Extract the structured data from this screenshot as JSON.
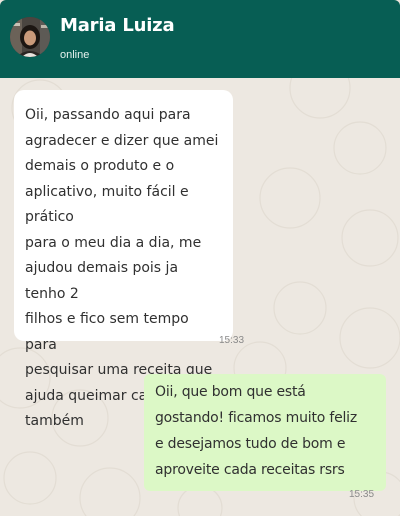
{
  "contact": {
    "name": "Maria Luiza",
    "status": "online"
  },
  "messages": [
    {
      "direction": "incoming",
      "text": "Oii, passando aqui para\nagradecer e dizer que amei\ndemais o produto e o\naplicativo, muito fácil e prático\npara o meu dia a dia, me\najudou demais pois ja tenho 2\nfilhos e fico sem tempo para\npesquisar uma receita que\najuda queimar calorias\ntambém",
      "time": "15:33"
    },
    {
      "direction": "outgoing",
      "text": "Oii, que bom que está\ngostando! ficamos muito feliz\ne desejamos tudo de bom e\naproveite cada receitas rsrs",
      "time": "15:35"
    }
  ],
  "colors": {
    "header": "#075e54",
    "incoming_bubble": "#ffffff",
    "outgoing_bubble": "#dcf8c6",
    "chat_background": "#ede8e1"
  }
}
